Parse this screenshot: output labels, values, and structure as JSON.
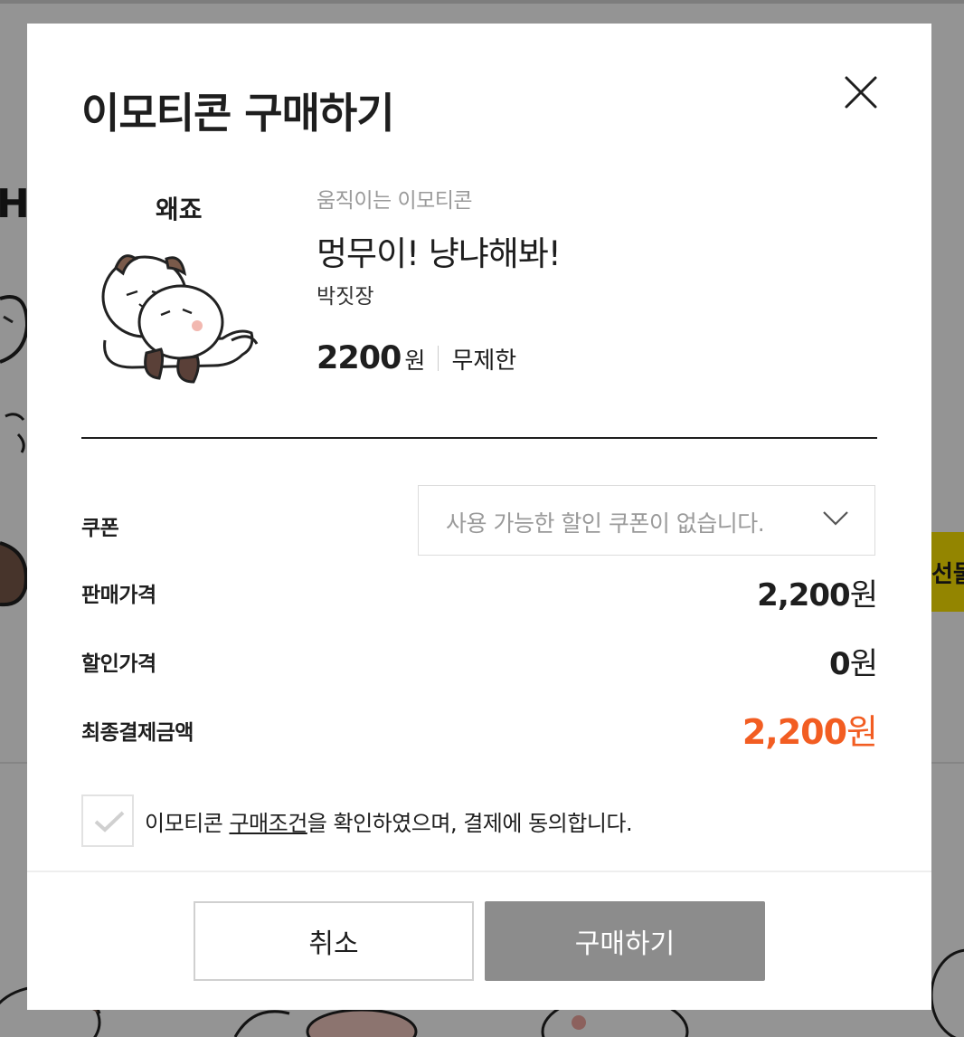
{
  "background": {
    "gift_tab_label": "선물",
    "cut_text": "H:"
  },
  "modal": {
    "title": "이모티콘 구매하기",
    "product": {
      "sticker_caption": "왜죠",
      "type": "움직이는 이모티콘",
      "name": "멍무이! 냥냐해봐!",
      "author": "박짓장",
      "price": "2200",
      "price_unit": "원",
      "period": "무제한"
    },
    "coupon": {
      "label": "쿠폰",
      "placeholder": "사용 가능한 할인 쿠폰이 없습니다."
    },
    "sale_price": {
      "label": "판매가격",
      "value": "2,200",
      "unit": "원"
    },
    "discount_price": {
      "label": "할인가격",
      "value": "0",
      "unit": "원"
    },
    "final_price": {
      "label": "최종결제금액",
      "value": "2,200",
      "unit": "원"
    },
    "agreement": {
      "checked": false,
      "prefix": "이모티콘 ",
      "link": "구매조건",
      "suffix": "을 확인하였으며, 결제에 동의합니다."
    },
    "buttons": {
      "cancel": "취소",
      "buy": "구매하기"
    }
  },
  "colors": {
    "final_price": "#f25d22",
    "buy_button_disabled": "#8c8c8c",
    "gift_tab": "#fee500"
  }
}
